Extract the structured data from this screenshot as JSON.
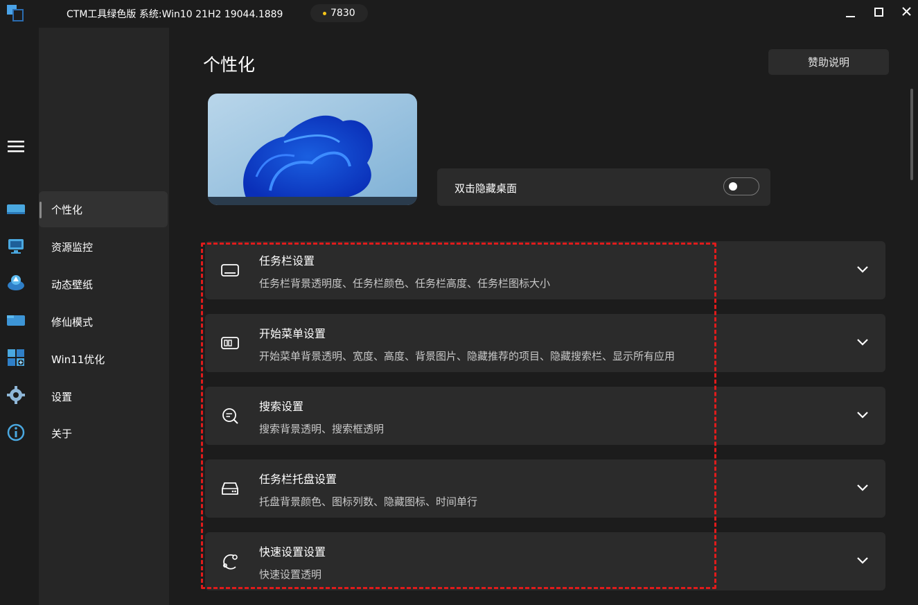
{
  "titlebar": {
    "title": "CTM工具绿色版  系统:Win10 21H2 19044.1889",
    "coins": "7830",
    "icons": [
      "app-logo",
      "minimize-icon",
      "maximize-icon",
      "close-icon"
    ]
  },
  "rail": {
    "icons": [
      "hamburger-menu-icon",
      "monitor-icon",
      "resource-monitor-icon",
      "wallpaper-icon",
      "folder-icon",
      "windows-icon",
      "gear-icon",
      "info-icon"
    ]
  },
  "sidebar": {
    "items": [
      {
        "label": "个性化",
        "active": true
      },
      {
        "label": "资源监控"
      },
      {
        "label": "动态壁纸"
      },
      {
        "label": "修仙模式"
      },
      {
        "label": "Win11优化"
      },
      {
        "label": "设置"
      },
      {
        "label": "关于"
      }
    ]
  },
  "main": {
    "title": "个性化",
    "help_label": "赞助说明",
    "toggle": {
      "label": "双击隐藏桌面",
      "on": false
    },
    "settings": [
      {
        "title": "任务栏设置",
        "desc": "任务栏背景透明度、任务栏颜色、任务栏高度、任务栏图标大小",
        "icon": "taskbar-icon"
      },
      {
        "title": "开始菜单设置",
        "desc": "开始菜单背景透明、宽度、高度、背景图片、隐藏推荐的项目、隐藏搜索栏、显示所有应用",
        "icon": "start-menu-icon"
      },
      {
        "title": "搜索设置",
        "desc": "搜索背景透明、搜索框透明",
        "icon": "search-icon"
      },
      {
        "title": "任务栏托盘设置",
        "desc": "托盘背景颜色、图标列数、隐藏图标、时间单行",
        "icon": "tray-icon"
      },
      {
        "title": "快速设置设置",
        "desc": "快速设置透明",
        "icon": "quick-settings-icon"
      }
    ]
  },
  "colors": {
    "background": "#1c1c1c",
    "sidebar": "#262626",
    "card": "#2b2b2b",
    "highlight": "#e01b1b",
    "coin": "#f5c518"
  }
}
